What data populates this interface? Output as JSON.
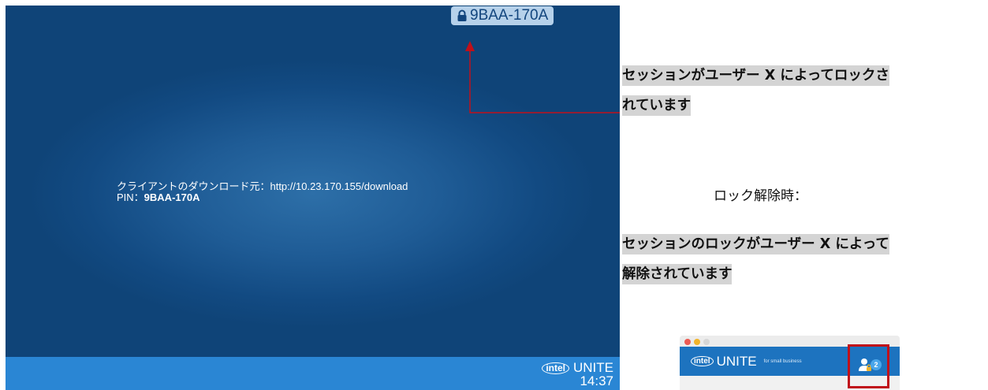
{
  "screen": {
    "pin_badge": "9BAA-170A",
    "client_label": "クライアントのダウンロード元：http://10.23.170.155/download",
    "pin_label": "PIN：",
    "pin_value": "9BAA-170A",
    "brand_intel": "intel",
    "brand_unite": "UNITE",
    "clock": "14:37"
  },
  "annotations": {
    "locked_line1": "セッションがユーザー X によってロックさ",
    "locked_line2": "れています",
    "unlock_label": "ロック解除時：",
    "unlocked_line1": "セッションのロックがユーザー X によって",
    "unlocked_line2": "解除されています"
  },
  "mini_app": {
    "brand_intel": "intel",
    "brand_unite": "UNITE",
    "subtitle": "for small business",
    "user_count": "2"
  },
  "colors": {
    "screen_bg": "#124a82",
    "taskbar": "#2a86d4",
    "arrow": "#c0101a",
    "badge_bg": "#b6d1ea",
    "highlight": "#d4d4d4"
  },
  "icons": [
    "lock-icon",
    "users-icon",
    "intel-logo"
  ]
}
